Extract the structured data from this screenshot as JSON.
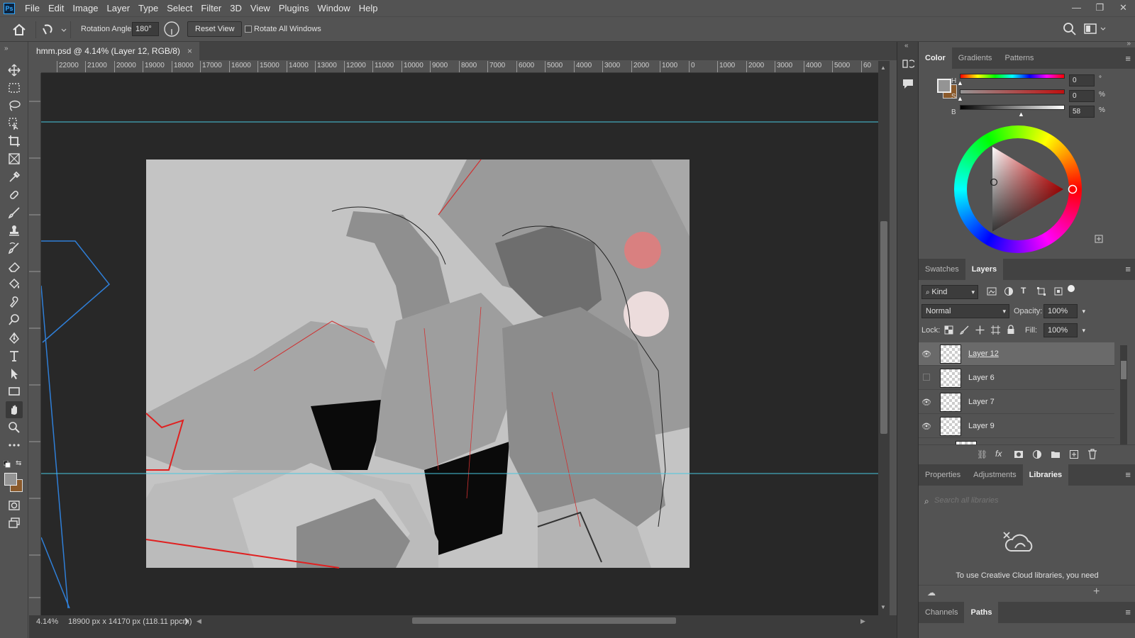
{
  "app": {
    "logo": "Ps"
  },
  "menu": [
    "File",
    "Edit",
    "Image",
    "Layer",
    "Type",
    "Select",
    "Filter",
    "3D",
    "View",
    "Plugins",
    "Window",
    "Help"
  ],
  "window_controls": {
    "minimize": "—",
    "restore": "❐",
    "close": "✕"
  },
  "options": {
    "rotation_label": "Rotation Angle:",
    "rotation_value": "180°",
    "reset_view": "Reset View",
    "rotate_all": "Rotate All Windows"
  },
  "document": {
    "tab_title": "hmm.psd @ 4.14% (Layer 12, RGB/8)",
    "close": "×"
  },
  "ruler_ticks": [
    "22000",
    "21000",
    "20000",
    "19000",
    "18000",
    "17000",
    "16000",
    "15000",
    "14000",
    "13000",
    "12000",
    "11000",
    "10000",
    "9000",
    "8000",
    "7000",
    "6000",
    "5000",
    "4000",
    "3000",
    "2000",
    "1000",
    "0",
    "1000",
    "2000",
    "3000",
    "4000",
    "5000",
    "60"
  ],
  "status": {
    "zoom": "4.14%",
    "info": "18900 px x 14170 px (118.11 ppcm)",
    "arrow": "❯"
  },
  "color_panel": {
    "tabs": [
      "Color",
      "Gradients",
      "Patterns"
    ],
    "active_tab": "Color",
    "channels": [
      {
        "label": "H",
        "value": "0",
        "unit": "°"
      },
      {
        "label": "S",
        "value": "0",
        "unit": "%"
      },
      {
        "label": "B",
        "value": "58",
        "unit": "%"
      }
    ],
    "foreground": "#949494",
    "background": "#8b5a2b"
  },
  "layers_panel": {
    "tabs": [
      "Swatches",
      "Layers"
    ],
    "active_tab": "Layers",
    "filter": "Kind",
    "blend_mode": "Normal",
    "opacity_label": "Opacity:",
    "opacity": "100%",
    "lock_label": "Lock:",
    "fill_label": "Fill:",
    "fill": "100%",
    "layers": [
      {
        "name": "Layer 12",
        "visible": true,
        "selected": true
      },
      {
        "name": "Layer 6",
        "visible": false,
        "selected": false
      },
      {
        "name": "Layer 7",
        "visible": true,
        "selected": false
      },
      {
        "name": "Layer 9",
        "visible": true,
        "selected": false
      }
    ]
  },
  "libraries_panel": {
    "tabs": [
      "Properties",
      "Adjustments",
      "Libraries"
    ],
    "active_tab": "Libraries",
    "search_placeholder": "Search all libraries",
    "message": "To use Creative Cloud libraries, you need"
  },
  "bottom_panel": {
    "tabs": [
      "Channels",
      "Paths"
    ],
    "active_tab": "Paths"
  }
}
